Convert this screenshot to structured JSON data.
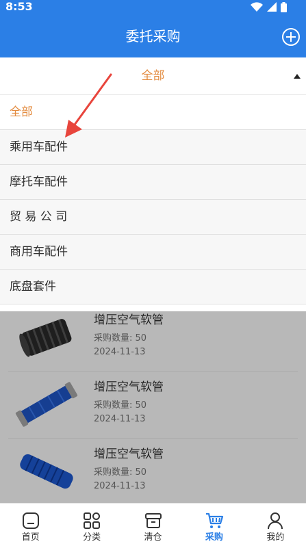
{
  "status": {
    "time": "8:53"
  },
  "header": {
    "title": "委托采购"
  },
  "filter": {
    "current": "全部",
    "options": [
      "全部",
      "乘用车配件",
      "摩托车配件",
      "贸 易 公 司",
      "商用车配件",
      "底盘套件"
    ]
  },
  "items": [
    {
      "name": "增压空气软管",
      "qty": "采购数量: 50",
      "date": "2024-11-13"
    },
    {
      "name": "增压空气软管",
      "qty": "采购数量: 50",
      "date": "2024-11-13"
    },
    {
      "name": "增压空气软管",
      "qty": "采购数量: 50",
      "date": "2024-11-13"
    }
  ],
  "tabs": [
    {
      "label": "首页",
      "icon": "home-icon"
    },
    {
      "label": "分类",
      "icon": "grid-icon"
    },
    {
      "label": "清仓",
      "icon": "box-icon"
    },
    {
      "label": "采购",
      "icon": "cart-icon",
      "active": true
    },
    {
      "label": "我的",
      "icon": "user-icon"
    }
  ],
  "colors": {
    "primary": "#2b7fe6",
    "accent": "#e38b3f",
    "arrow": "#e8453c"
  }
}
